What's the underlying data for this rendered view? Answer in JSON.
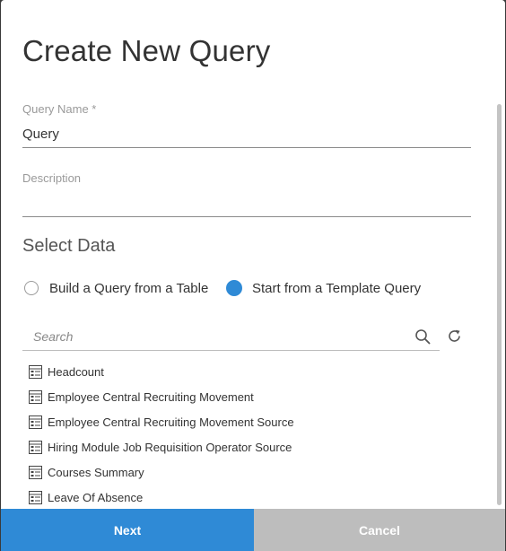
{
  "dialog": {
    "title": "Create New Query",
    "query_name": {
      "label": "Query Name *",
      "value": "Query"
    },
    "description": {
      "label": "Description",
      "value": ""
    },
    "select_data": {
      "title": "Select Data",
      "options": [
        {
          "label": "Build a Query from a Table",
          "checked": false
        },
        {
          "label": "Start from a Template Query",
          "checked": true
        }
      ]
    },
    "search": {
      "placeholder": "Search",
      "icon": "search-icon",
      "refresh_icon": "refresh-icon"
    },
    "templates": [
      "Headcount",
      "Employee Central Recruiting Movement",
      "Employee Central Recruiting Movement Source",
      "Hiring Module Job Requisition Operator Source",
      "Courses Summary",
      "Leave Of Absence"
    ],
    "footer": {
      "next_label": "Next",
      "cancel_label": "Cancel"
    },
    "colors": {
      "accent": "#2f8ad6",
      "cancel_bg": "#bdbdbd",
      "backdrop": "#3a3a3a"
    }
  }
}
